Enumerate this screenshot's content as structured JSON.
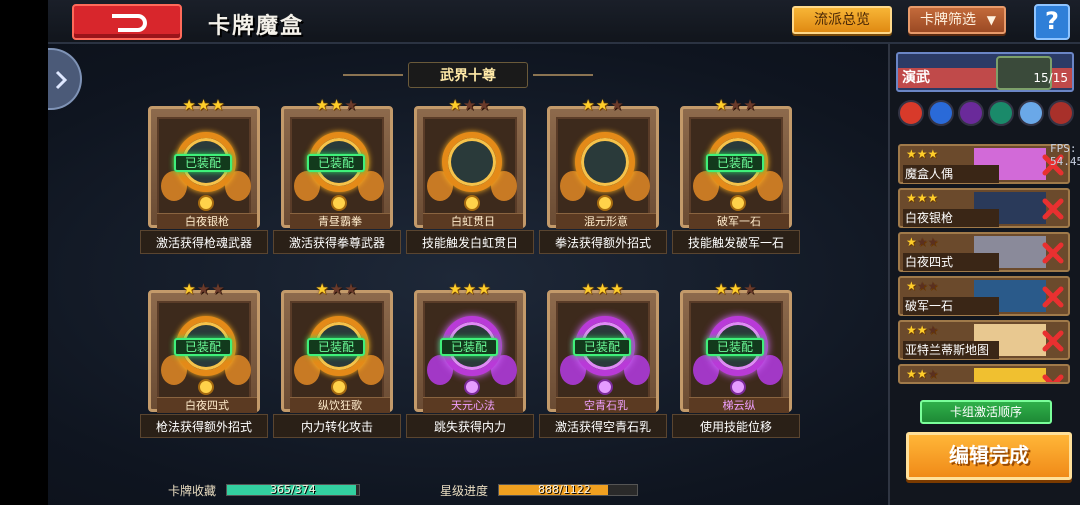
{
  "header": {
    "title": "卡牌魔盒",
    "school_overview_label": "流派总览",
    "card_filter_label": "卡牌筛选",
    "help_label": "?"
  },
  "section": {
    "title": "武界十尊"
  },
  "cards": [
    {
      "name": "白夜银枪",
      "desc": "激活获得枪魂武器",
      "stars": 3,
      "stars_max": 3,
      "equipped": true,
      "equipped_label": "已装配",
      "rarity": "orange"
    },
    {
      "name": "青昼霸拳",
      "desc": "激活获得拳尊武器",
      "stars": 2,
      "stars_max": 3,
      "equipped": true,
      "equipped_label": "已装配",
      "rarity": "orange"
    },
    {
      "name": "白虹贯日",
      "desc": "技能触发白虹贯日",
      "stars": 1,
      "stars_max": 3,
      "equipped": false,
      "equipped_label": "",
      "rarity": "orange"
    },
    {
      "name": "混元形意",
      "desc": "拳法获得额外招式",
      "stars": 2,
      "stars_max": 3,
      "equipped": false,
      "equipped_label": "",
      "rarity": "orange"
    },
    {
      "name": "破军一石",
      "desc": "技能触发破军一石",
      "stars": 1,
      "stars_max": 3,
      "equipped": true,
      "equipped_label": "已装配",
      "rarity": "orange"
    },
    {
      "name": "白夜四式",
      "desc": "枪法获得额外招式",
      "stars": 1,
      "stars_max": 3,
      "equipped": true,
      "equipped_label": "已装配",
      "rarity": "orange"
    },
    {
      "name": "纵饮狂歌",
      "desc": "内力转化攻击",
      "stars": 1,
      "stars_max": 3,
      "equipped": true,
      "equipped_label": "已装配",
      "rarity": "orange"
    },
    {
      "name": "天元心法",
      "desc": "跳失获得内力",
      "stars": 3,
      "stars_max": 3,
      "equipped": true,
      "equipped_label": "已装配",
      "rarity": "purple"
    },
    {
      "name": "空青石乳",
      "desc": "激活获得空青石乳",
      "stars": 3,
      "stars_max": 3,
      "equipped": true,
      "equipped_label": "已装配",
      "rarity": "purple"
    },
    {
      "name": "梯云纵",
      "desc": "使用技能位移",
      "stars": 2,
      "stars_max": 3,
      "equipped": true,
      "equipped_label": "已装配",
      "rarity": "purple"
    }
  ],
  "progress": {
    "collection_label": "卡牌收藏",
    "collection_value": "365/374",
    "collection_fraction": 0.976,
    "star_label": "星级进度",
    "star_value": "888/1122",
    "star_fraction": 0.791
  },
  "deck": {
    "title": "演武",
    "count": "15/15",
    "fps": "FPS: 54.45",
    "items": [
      {
        "name": "魔盒人偶",
        "stars": 3,
        "stars_max": 3
      },
      {
        "name": "白夜银枪",
        "stars": 3,
        "stars_max": 3
      },
      {
        "name": "白夜四式",
        "stars": 1,
        "stars_max": 3
      },
      {
        "name": "破军一石",
        "stars": 1,
        "stars_max": 3
      },
      {
        "name": "亚特兰蒂斯地图",
        "stars": 2,
        "stars_max": 3
      },
      {
        "name": "",
        "stars": 2,
        "stars_max": 3
      }
    ],
    "activation_order_label": "卡组激活顺序",
    "done_label": "编辑完成"
  },
  "colors": {
    "accent_orange": "#f0a020",
    "equipped_green": "#3ff07a",
    "purple_rarity": "#b93ad8",
    "remove_red": "#e83030"
  }
}
